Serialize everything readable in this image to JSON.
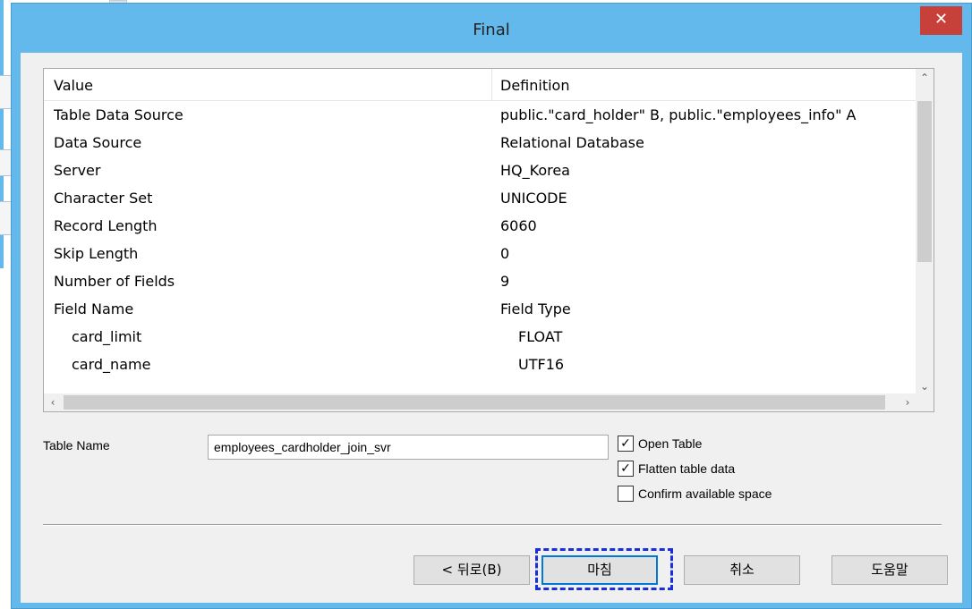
{
  "dialog": {
    "title": "Final",
    "close_glyph": "✕"
  },
  "list": {
    "columns": {
      "value": "Value",
      "definition": "Definition"
    },
    "rows": [
      {
        "value": "Table Data Source",
        "definition": "public.\"card_holder\" B, public.\"employees_info\" A"
      },
      {
        "value": "Data Source",
        "definition": "Relational Database"
      },
      {
        "value": "Server",
        "definition": "HQ_Korea"
      },
      {
        "value": "Character Set",
        "definition": "UNICODE"
      },
      {
        "value": "Record Length",
        "definition": "6060"
      },
      {
        "value": "Skip Length",
        "definition": "0"
      },
      {
        "value": "Number of Fields",
        "definition": "9"
      },
      {
        "value": "Field Name",
        "definition": "Field Type"
      },
      {
        "value": "card_limit",
        "definition": "FLOAT"
      },
      {
        "value": "card_name",
        "definition": "UTF16"
      }
    ]
  },
  "form": {
    "table_name_label": "Table Name",
    "table_name_value": "employees_cardholder_join_svr",
    "options": [
      {
        "label": "Open Table",
        "checked": true
      },
      {
        "label": "Flatten table data",
        "checked": true
      },
      {
        "label": "Confirm available space",
        "checked": false
      }
    ]
  },
  "buttons": {
    "back": "< 뒤로(B)",
    "finish": "마침",
    "cancel": "취소",
    "help": "도움말"
  },
  "icons": {
    "scroll_up": "chevron-up-icon",
    "scroll_down": "chevron-down-icon",
    "scroll_left": "chevron-left-icon",
    "scroll_right": "chevron-right-icon",
    "checkmark": "checkmark-icon"
  }
}
